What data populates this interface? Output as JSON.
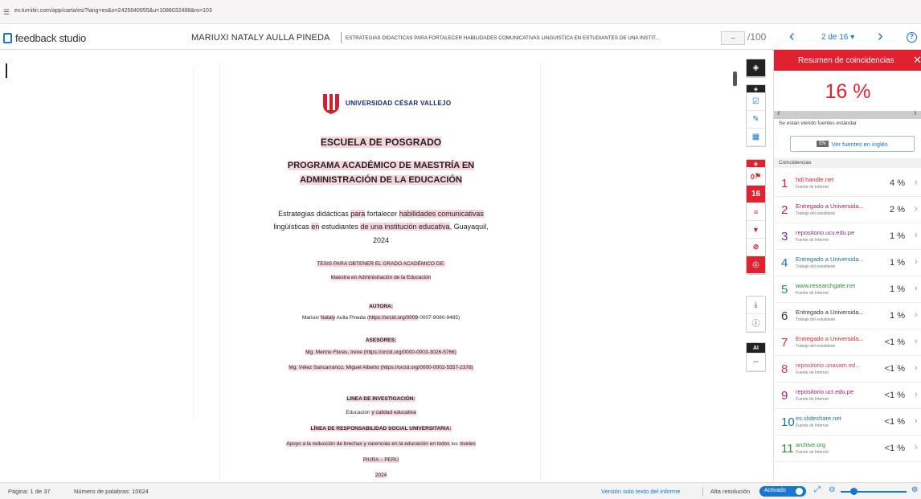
{
  "browser": {
    "url": "ev.turnitin.com/app/carta/es/?lang=es&o=2425840955&u=1088032488&ro=103"
  },
  "header": {
    "logo_text": "feedback studio",
    "author": "MARIUXI NATALY AULLA PINEDA",
    "document_title": "ESTRATEGIAS DIDÁCTICAS PARA FORTALECER HABILIDADES COMUNICATIVAS LINGÜÍSTICA EN ESTUDIANTES DE UNA INSTIT...",
    "score_value": "--",
    "score_max": "/100",
    "page_nav": "2 de 16 ▾",
    "accent_color": "#1676d2"
  },
  "document": {
    "university": "UNIVERSIDAD CÉSAR VALLEJO",
    "school": "ESCUELA DE POSGRADO",
    "program_line1": "PROGRAMA ACADÉMICO DE MAESTRÍA EN",
    "program_line2": "ADMINISTRACIÓN DE LA EDUCACIÓN",
    "title": {
      "l1_a": "Estrategias didácticas ",
      "l1_b": "para",
      "l1_c": " fortalecer ",
      "l1_d": "habilidades comunicativas",
      "l2_a": "lingüísticas ",
      "l2_b": "en",
      "l2_c": " estudiantes ",
      "l2_d": "de una institución educativa",
      "l2_e": ", Guayaquil,",
      "l3": "2024"
    },
    "thesis_purpose": "TESIS PARA OBTENER EL GRADO ACADÉMICO DE:",
    "degree": "Maestra en Administración de la Educación",
    "author_label": "AUTORA:",
    "author_a": "Mariuxi ",
    "author_b": "Nataly",
    "author_c": " Aulla Pineda (",
    "author_d": "https://orcid.org/0009",
    "author_e": "-0007-9080-9485)",
    "advisors_label": "ASESORES:",
    "advisor1": "Mg. Merino Flores, Irene (https://orcid.org/0000-0003-3026-5766)",
    "advisor2": "Mg. Vélez Sancarranco, Miguel Alberto (https://orcid.org/0000-0002-5557-2378)",
    "research_line_label": "LINEA DE INVESTIGACIÓN:",
    "research_a": "Educación ",
    "research_b": "y calidad educativa",
    "rsu_label": "LÍNEA DE RESPONSABILIDAD SOCIAL UNIVERSITARIA:",
    "rsu_a": "Apoyo a la reducción de brechas y carencias en la educación en todos",
    "rsu_b": " los ",
    "rsu_c": "niveles",
    "place": "PIURA – PERÚ",
    "year": "2024"
  },
  "toolbar": {
    "match_count": "16",
    "flag_count": "0",
    "ai_label": "AI",
    "ai_value": "--"
  },
  "sidebar": {
    "title": "Resumen de coincidencias",
    "percentage": "16 %",
    "sources_note": "Se están viendo fuentes estándar",
    "english_badge": "EN",
    "english_button": "Ver fuentes en inglés",
    "section_label": "Coincidencias",
    "matches": [
      {
        "num": "1",
        "source": "hdl.handle.net",
        "type": "Fuente de Internet",
        "pct": "4 %",
        "color": "#e0212f"
      },
      {
        "num": "2",
        "source": "Entregado a Universida...",
        "type": "Trabajo del estudiante",
        "pct": "2 %",
        "color": "#a3206c"
      },
      {
        "num": "3",
        "source": "repositorio.ucv.edu.pe",
        "type": "Fuente de Internet",
        "pct": "1 %",
        "color": "#7e2d86"
      },
      {
        "num": "4",
        "source": "Entregado a Universida...",
        "type": "Trabajo del estudiante",
        "pct": "1 %",
        "color": "#1c6fa3"
      },
      {
        "num": "5",
        "source": "www.researchgate.net",
        "type": "Fuente de Internet",
        "pct": "1 %",
        "color": "#2f8a3a"
      },
      {
        "num": "6",
        "source": "Entregado a Universida...",
        "type": "Trabajo del estudiante",
        "pct": "1 %",
        "color": "#333333"
      },
      {
        "num": "7",
        "source": "Entregado a Universida...",
        "type": "Trabajo del estudiante",
        "pct": "<1 %",
        "color": "#e0212f"
      },
      {
        "num": "8",
        "source": "repositorio.unasam.ed...",
        "type": "Fuente de Internet",
        "pct": "<1 %",
        "color": "#d6336c"
      },
      {
        "num": "9",
        "source": "repositorio.uct.edu.pe",
        "type": "Fuente de Internet",
        "pct": "<1 %",
        "color": "#a3206c"
      },
      {
        "num": "10",
        "source": "es.slideshare.net",
        "type": "Fuente de Internet",
        "pct": "<1 %",
        "color": "#1c6fa3"
      },
      {
        "num": "11",
        "source": "archive.org",
        "type": "Fuente de Internet",
        "pct": "<1 %",
        "color": "#2f8a3a"
      }
    ]
  },
  "status": {
    "page": "Página: 1 de 37",
    "words": "Número de palabras: 10624",
    "text_only": "Versión solo texto del informe",
    "hires_label": "Alta resolución",
    "hires_state": "Activado"
  }
}
